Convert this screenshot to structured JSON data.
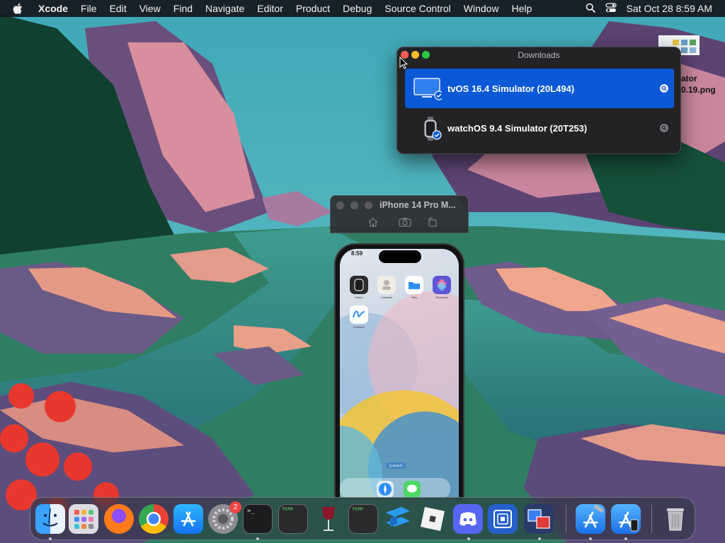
{
  "menubar": {
    "app_name": "Xcode",
    "items": [
      "File",
      "Edit",
      "View",
      "Find",
      "Navigate",
      "Editor",
      "Product",
      "Debug",
      "Source Control",
      "Window",
      "Help"
    ],
    "clock": "Sat Oct 28  8:59 AM",
    "icons": [
      "apple-icon",
      "search-icon",
      "control-center-icon"
    ]
  },
  "desktop_file": {
    "name_line1": "ator",
    "name_line2": "0.19.png"
  },
  "downloads_window": {
    "title": "Downloads",
    "items": [
      {
        "name": "tvOS 16.4 Simulator (20L494)",
        "icon": "tv-icon",
        "selected": true
      },
      {
        "name": "watchOS 9.4 Simulator (20T253)",
        "icon": "watch-icon",
        "selected": false
      }
    ]
  },
  "simulator": {
    "title": "iPhone 14 Pro M...",
    "toolbar_icons": [
      "home-icon",
      "screenshot-icon",
      "rotate-icon"
    ],
    "status_time": "8:59",
    "apps": [
      {
        "label": "Watch",
        "color": "#2b2b2e"
      },
      {
        "label": "Contacts",
        "color": "#f0ece6"
      },
      {
        "label": "Files",
        "color": "#ffffff"
      },
      {
        "label": "Shortcuts",
        "color": "#5b57d6"
      },
      {
        "label": "Freeform",
        "color": "#ffffff"
      }
    ],
    "search_label": "Q Search"
  },
  "dock": {
    "apps": [
      {
        "name": "Finder",
        "running": true
      },
      {
        "name": "Launchpad",
        "running": false
      },
      {
        "name": "Firefox",
        "running": false
      },
      {
        "name": "Chrome",
        "running": false
      },
      {
        "name": "App Store",
        "running": false
      },
      {
        "name": "System Settings",
        "running": false,
        "badge": "2"
      },
      {
        "name": "Terminal",
        "running": true
      },
      {
        "name": "Console",
        "running": false
      },
      {
        "name": "Wine",
        "running": false
      },
      {
        "name": "Console 2",
        "running": false
      },
      {
        "name": "Stack",
        "running": false
      },
      {
        "name": "Roblox",
        "running": false
      },
      {
        "name": "Discord",
        "running": true
      },
      {
        "name": "Memory Utility",
        "running": false
      },
      {
        "name": "Migration",
        "running": true
      },
      {
        "name": "Xcode",
        "running": true
      },
      {
        "name": "Simulator",
        "running": true
      },
      {
        "name": "Trash",
        "running": false
      }
    ],
    "terminal_prompt": ">_",
    "console_text": "PERM"
  },
  "colors": {
    "accent": "#0b59d6",
    "menubar": "#14161c",
    "close": "#ff5f57",
    "minimize": "#febc2e",
    "zoom": "#28c840"
  }
}
